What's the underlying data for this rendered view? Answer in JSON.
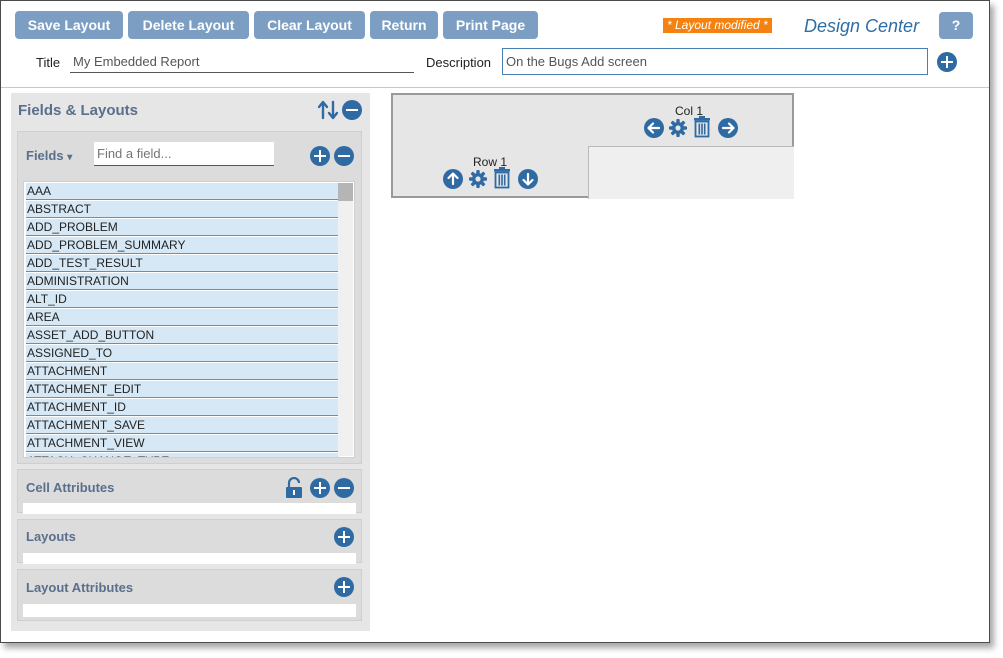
{
  "toolbar": {
    "save_layout": "Save Layout",
    "delete_layout": "Delete Layout",
    "clear_layout": "Clear Layout",
    "return": "Return",
    "print_page": "Print Page",
    "modified_badge": "* Layout modified *",
    "app_title": "Design Center",
    "help": "?"
  },
  "form": {
    "title_label": "Title",
    "title_value": "My Embedded Report",
    "description_label": "Description",
    "description_value": "On the Bugs Add screen"
  },
  "left_panel": {
    "title": "Fields & Layouts",
    "fields": {
      "label": "Fields",
      "dropdown_arrow": "▾",
      "search_placeholder": "Find a field...",
      "items": [
        "AAA",
        "ABSTRACT",
        "ADD_PROBLEM",
        "ADD_PROBLEM_SUMMARY",
        "ADD_TEST_RESULT",
        "ADMINISTRATION",
        "ALT_ID",
        "AREA",
        "ASSET_ADD_BUTTON",
        "ASSIGNED_TO",
        "ATTACHMENT",
        "ATTACHMENT_EDIT",
        "ATTACHMENT_ID",
        "ATTACHMENT_SAVE",
        "ATTACHMENT_VIEW",
        "ATTACH_CHANGE_TYPE"
      ]
    },
    "cell_attributes": "Cell Attributes",
    "layouts": "Layouts",
    "layout_attributes": "Layout Attributes"
  },
  "canvas": {
    "col_label": "Col 1",
    "row_label": "Row 1"
  },
  "colors": {
    "button": "#7c9ec3",
    "accent_icon": "#2f6aa3",
    "badge": "#f5820f",
    "title_text": "#2e6ea6"
  }
}
